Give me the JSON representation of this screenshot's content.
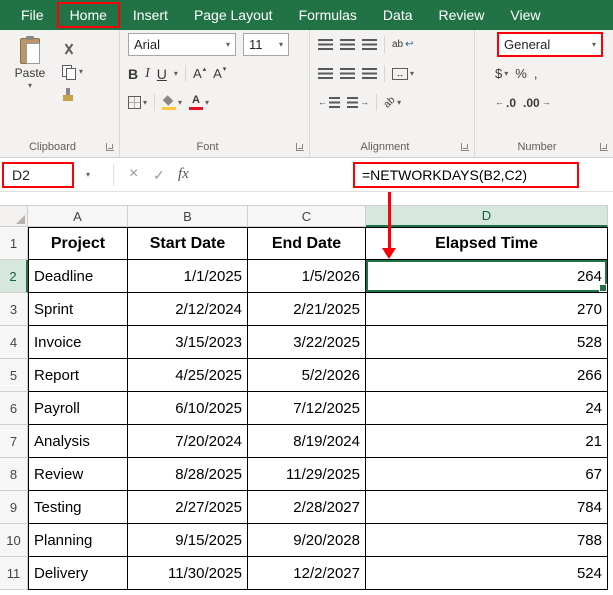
{
  "colors": {
    "excel_green": "#217346",
    "annotation_red": "#fb0007",
    "selected_header_fill": "#d6e8de"
  },
  "tabbar": {
    "tabs": [
      "File",
      "Home",
      "Insert",
      "Page Layout",
      "Formulas",
      "Data",
      "Review",
      "View"
    ],
    "active_tab": "Home"
  },
  "ribbon": {
    "clipboard": {
      "label": "Clipboard",
      "paste": "Paste"
    },
    "font": {
      "label": "Font",
      "font_name": "Arial",
      "font_size": "11",
      "bold": "B",
      "italic": "I",
      "underline": "U",
      "grow": "A",
      "shrink": "A",
      "color_letter": "A"
    },
    "alignment": {
      "label": "Alignment",
      "wrap_ab": "ab",
      "orientation_ab": "ab"
    },
    "number": {
      "label": "Number",
      "format": "General",
      "dollar": "$",
      "percent": "%",
      "comma": ",",
      "inc_decimal": ".0",
      "dec_decimal": ".00"
    }
  },
  "icons": {
    "dropdown": "▾",
    "up_triangle": "▴",
    "down_triangle": "▾",
    "cancel": "×",
    "enter": "✓",
    "fx": "fx",
    "return_arrow": "↩",
    "merge_arrows": "↔",
    "left_arrow": "←",
    "right_arrow": "→"
  },
  "formula_bar": {
    "name_box": "D2",
    "formula": "=NETWORKDAYS(B2,C2)"
  },
  "grid": {
    "column_letters": [
      "A",
      "B",
      "C",
      "D"
    ],
    "selected_column": "D",
    "selected_row": "2",
    "selected_cell": "D2",
    "header_row": [
      "Project",
      "Start Date",
      "End Date",
      "Elapsed Time"
    ],
    "rows": [
      [
        "Deadline",
        "1/1/2025",
        "1/5/2026",
        "264"
      ],
      [
        "Sprint",
        "2/12/2024",
        "2/21/2025",
        "270"
      ],
      [
        "Invoice",
        "3/15/2023",
        "3/22/2025",
        "528"
      ],
      [
        "Report",
        "4/25/2025",
        "5/2/2026",
        "266"
      ],
      [
        "Payroll",
        "6/10/2025",
        "7/12/2025",
        "24"
      ],
      [
        "Analysis",
        "7/20/2024",
        "8/19/2024",
        "21"
      ],
      [
        "Review",
        "8/28/2025",
        "11/29/2025",
        "67"
      ],
      [
        "Testing",
        "2/27/2025",
        "2/28/2027",
        "784"
      ],
      [
        "Planning",
        "9/15/2025",
        "9/20/2028",
        "788"
      ],
      [
        "Delivery",
        "11/30/2025",
        "12/2/2027",
        "524"
      ]
    ]
  }
}
